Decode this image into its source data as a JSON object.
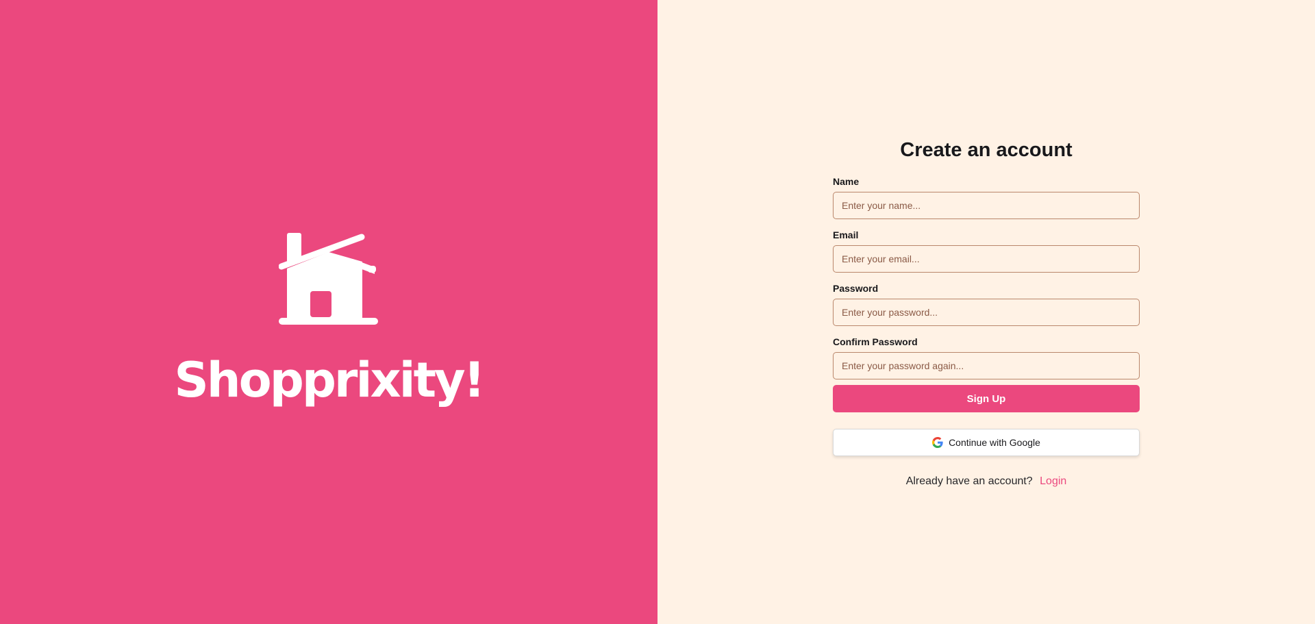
{
  "brand": {
    "name": "Shopprixity!",
    "logo_icon": "house-icon",
    "background_color": "#eb487e"
  },
  "form": {
    "title": "Create an account",
    "background_color": "#fff2e5",
    "fields": [
      {
        "label": "Name",
        "placeholder": "Enter your name...",
        "value": ""
      },
      {
        "label": "Email",
        "placeholder": "Enter your email...",
        "value": ""
      },
      {
        "label": "Password",
        "placeholder": "Enter your password...",
        "value": ""
      },
      {
        "label": "Confirm Password",
        "placeholder": "Enter your password again...",
        "value": ""
      }
    ],
    "signup_label": "Sign Up",
    "google_label": "Continue with Google",
    "google_icon": "google-icon",
    "login_prompt": "Already have an account?",
    "login_label": "Login",
    "accent_color": "#eb487e"
  }
}
